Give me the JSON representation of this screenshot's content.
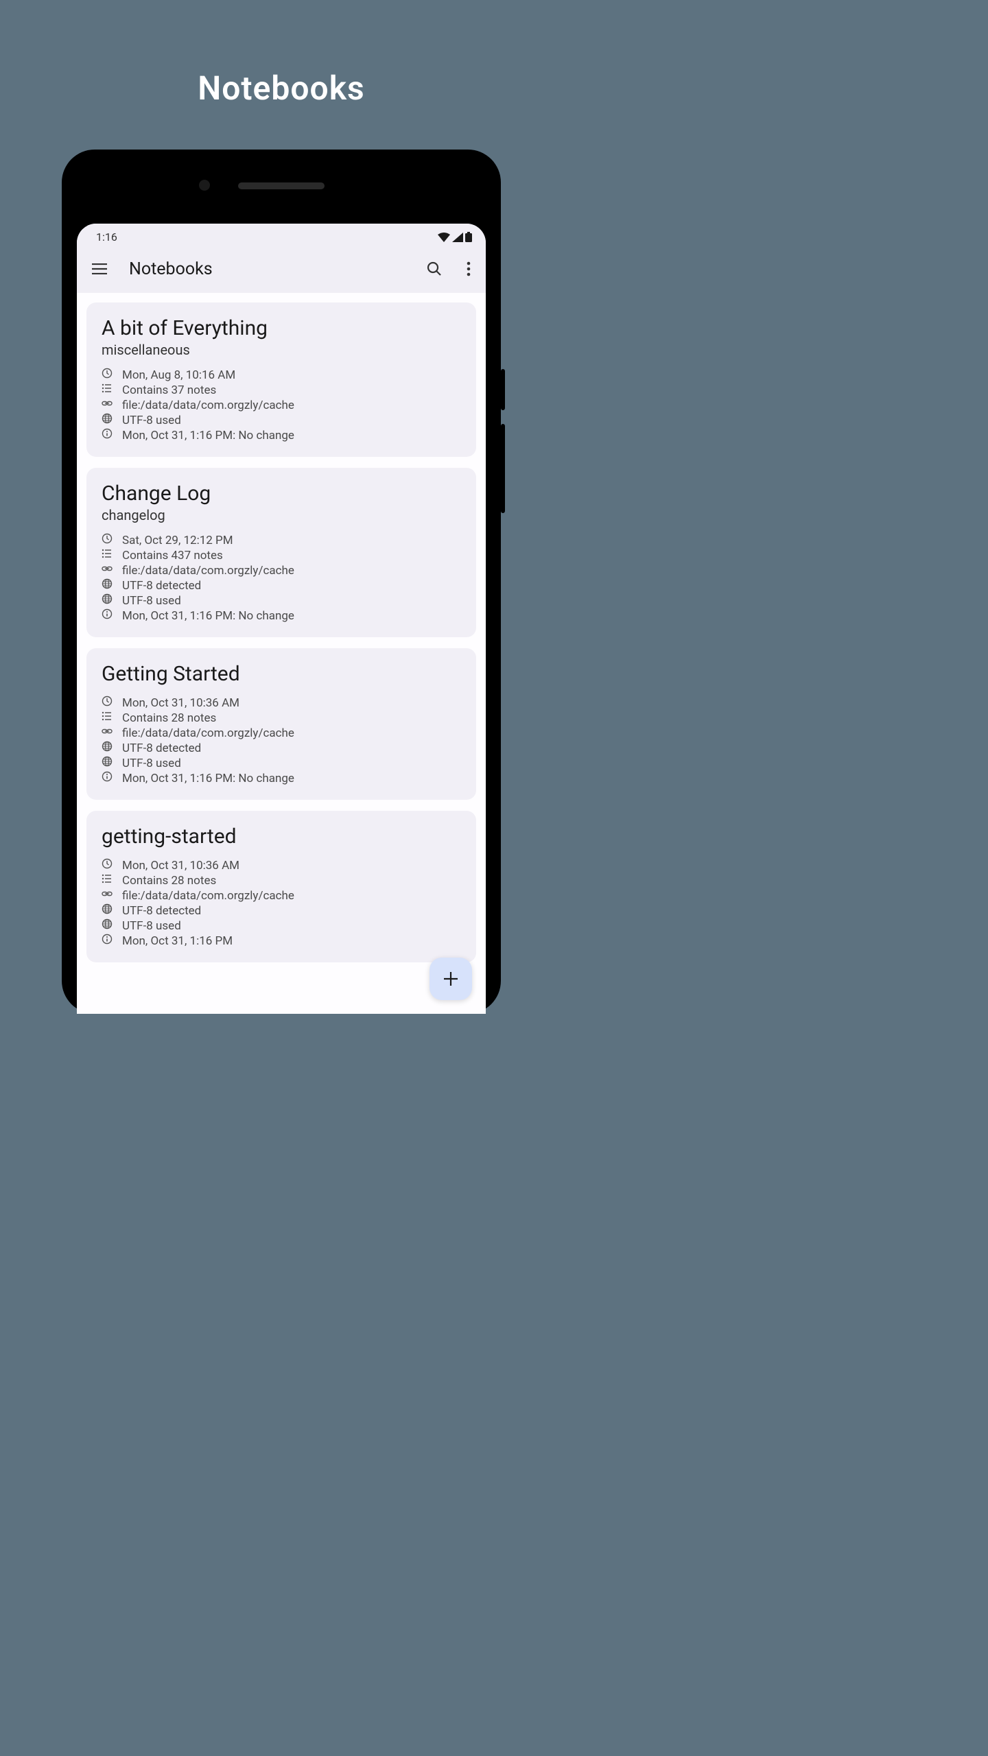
{
  "page": {
    "title": "Notebooks"
  },
  "statusBar": {
    "time": "1:16"
  },
  "appBar": {
    "title": "Notebooks"
  },
  "notebooks": [
    {
      "title": "A bit of Everything",
      "subtitle": "miscellaneous",
      "meta": [
        {
          "icon": "clock",
          "text": "Mon, Aug 8, 10:16 AM"
        },
        {
          "icon": "list",
          "text": "Contains 37 notes"
        },
        {
          "icon": "link",
          "text": "file:/data/data/com.orgzly/cache"
        },
        {
          "icon": "globe",
          "text": "UTF-8 used"
        },
        {
          "icon": "info",
          "text": "Mon, Oct 31, 1:16 PM: No change"
        }
      ]
    },
    {
      "title": "Change Log",
      "subtitle": "changelog",
      "meta": [
        {
          "icon": "clock",
          "text": "Sat, Oct 29, 12:12 PM"
        },
        {
          "icon": "list",
          "text": "Contains 437 notes"
        },
        {
          "icon": "link",
          "text": "file:/data/data/com.orgzly/cache"
        },
        {
          "icon": "globe",
          "text": "UTF-8 detected"
        },
        {
          "icon": "globe",
          "text": "UTF-8 used"
        },
        {
          "icon": "info",
          "text": "Mon, Oct 31, 1:16 PM: No change"
        }
      ]
    },
    {
      "title": "Getting Started",
      "subtitle": "",
      "meta": [
        {
          "icon": "clock",
          "text": "Mon, Oct 31, 10:36 AM"
        },
        {
          "icon": "list",
          "text": "Contains 28 notes"
        },
        {
          "icon": "link",
          "text": "file:/data/data/com.orgzly/cache"
        },
        {
          "icon": "globe",
          "text": "UTF-8 detected"
        },
        {
          "icon": "globe",
          "text": "UTF-8 used"
        },
        {
          "icon": "info",
          "text": "Mon, Oct 31, 1:16 PM: No change"
        }
      ]
    },
    {
      "title": "getting-started",
      "subtitle": "",
      "meta": [
        {
          "icon": "clock",
          "text": "Mon, Oct 31, 10:36 AM"
        },
        {
          "icon": "list",
          "text": "Contains 28 notes"
        },
        {
          "icon": "link",
          "text": "file:/data/data/com.orgzly/cache"
        },
        {
          "icon": "globe",
          "text": "UTF-8 detected"
        },
        {
          "icon": "globe",
          "text": "UTF-8 used"
        },
        {
          "icon": "info",
          "text": "Mon, Oct 31, 1:16 PM"
        }
      ]
    }
  ]
}
